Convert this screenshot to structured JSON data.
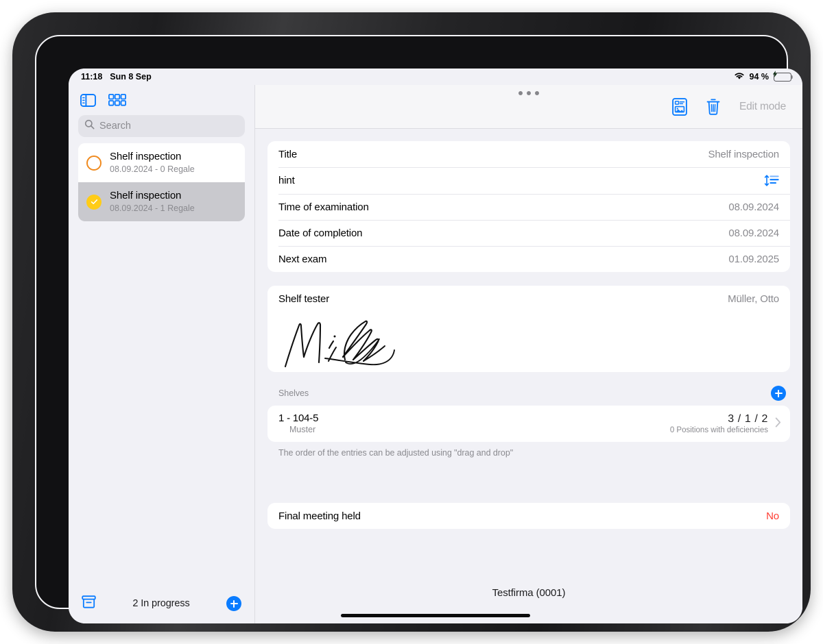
{
  "status_bar": {
    "time": "11:18",
    "date": "Sun 8 Sep",
    "battery_percent": "94 %",
    "wifi_icon": "wifi-icon",
    "battery_icon": "battery-charging-icon"
  },
  "sidebar": {
    "toggle_sidebar_icon": "sidebar-toggle-icon",
    "grid_view_icon": "grid-view-icon",
    "search": {
      "placeholder": "Search",
      "value": "",
      "icon": "search-icon"
    },
    "items": [
      {
        "title": "Shelf inspection",
        "subtitle": "08.09.2024 - 0 Regale",
        "status": "open",
        "status_icon": "circle-outline-icon",
        "status_color": "#f08a1e",
        "selected": false
      },
      {
        "title": "Shelf inspection",
        "subtitle": "08.09.2024 - 1 Regale",
        "status": "completed",
        "status_icon": "circle-check-filled-icon",
        "status_color": "#ffcc17",
        "selected": true
      }
    ],
    "footer": {
      "archive_icon": "archive-box-icon",
      "count_label": "2 In progress",
      "add_icon": "plus-circle-icon"
    }
  },
  "toolbar": {
    "report_icon": "document-card-icon",
    "delete_icon": "trash-icon",
    "edit_mode_label": "Edit mode",
    "multitask_icon": "multitasking-dots-icon"
  },
  "detail": {
    "info_rows": [
      {
        "label": "Title",
        "value": "Shelf inspection"
      },
      {
        "label": "hint",
        "value": "",
        "trailing_icon": "line-spacing-icon"
      },
      {
        "label": "Time of examination",
        "value": "08.09.2024"
      },
      {
        "label": "Date of completion",
        "value": "08.09.2024"
      },
      {
        "label": "Next exam",
        "value": "01.09.2025"
      }
    ],
    "tester": {
      "label": "Shelf tester",
      "value": "Müller, Otto",
      "signature_alt": "handwritten-signature"
    },
    "shelves": {
      "section_label": "Shelves",
      "add_icon": "plus-circle-icon",
      "entries": [
        {
          "title": "1 - 104-5",
          "subtitle": "Muster",
          "counts": "3 / 1 / 2",
          "deficiencies": "0 Positions with deficiencies",
          "chevron_icon": "chevron-right-icon"
        }
      ],
      "hint": "The order of the entries can be adjusted using \"drag and drop\""
    },
    "final_meeting": {
      "label": "Final meeting held",
      "value": "No",
      "value_color": "#ff3b30"
    },
    "company": "Testfirma (0001)"
  },
  "colors": {
    "accent_blue": "#0a7cff",
    "background": "#f1f1f6",
    "card": "#ffffff",
    "selected_row": "#c9c9ce",
    "muted_text": "#8a8a8f",
    "danger": "#ff3b30",
    "battery_green": "#32d74b"
  }
}
